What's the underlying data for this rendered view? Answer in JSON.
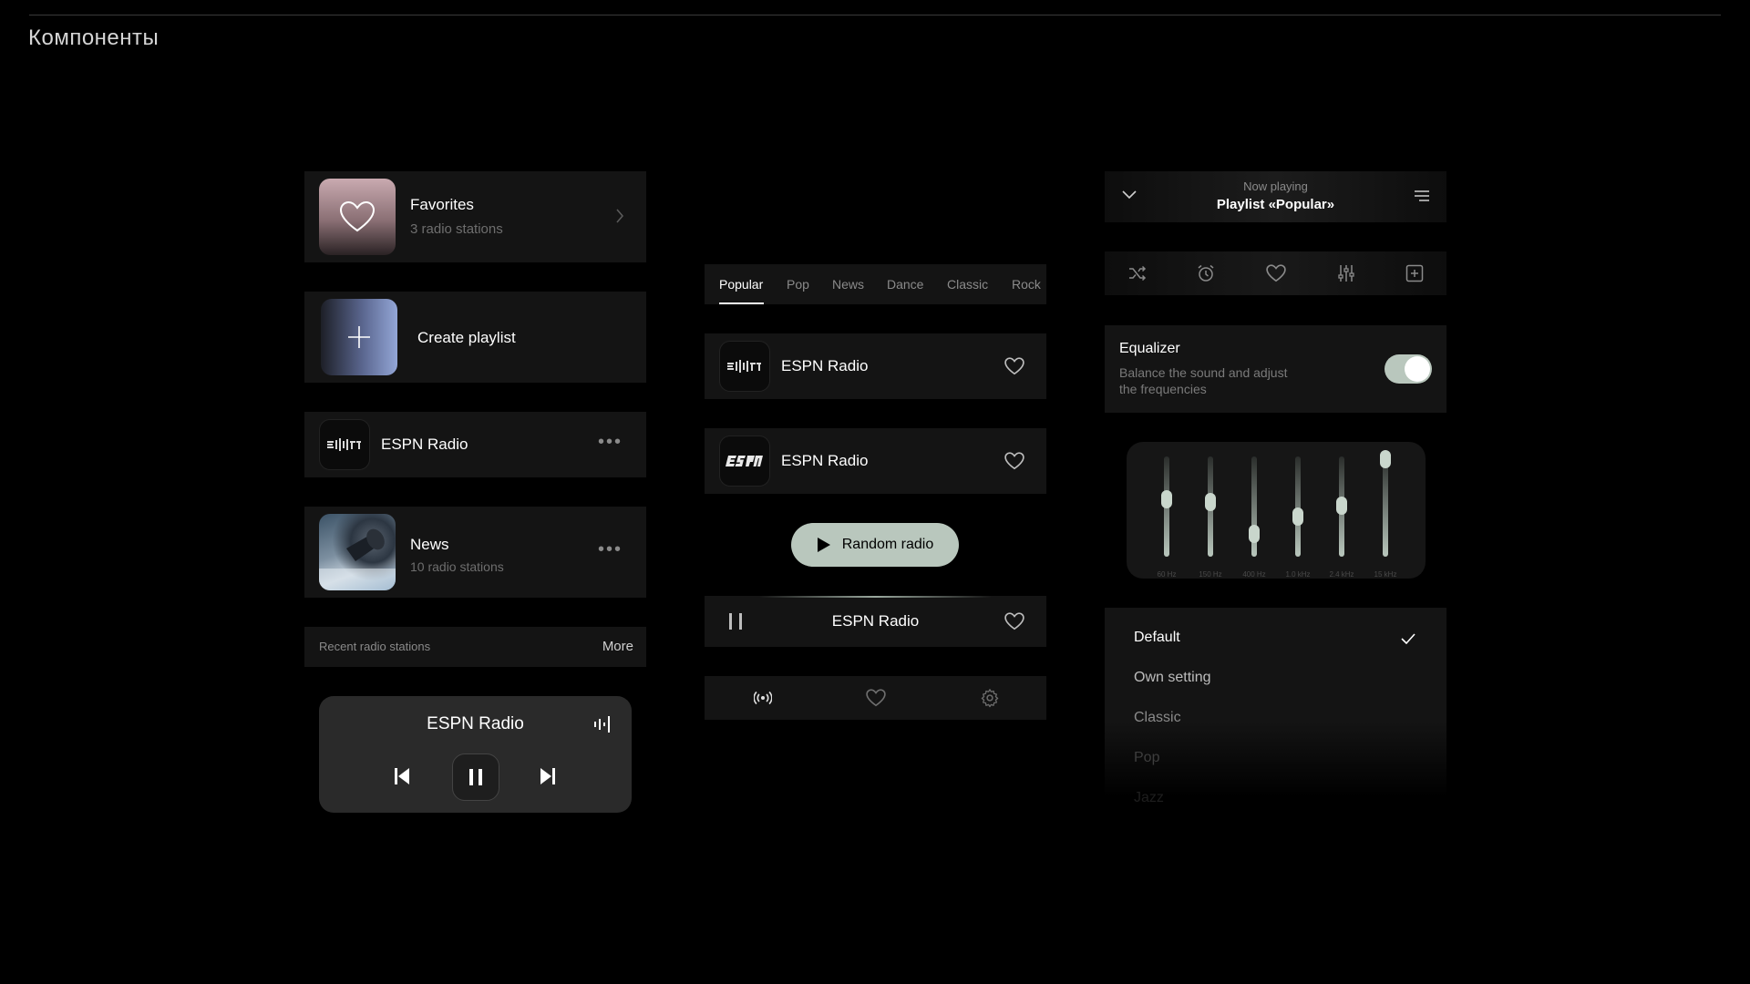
{
  "page": {
    "title": "Компоненты"
  },
  "favorites": {
    "title": "Favorites",
    "subtitle": "3 radio stations"
  },
  "create_playlist": {
    "label": "Create playlist"
  },
  "station_row": {
    "name": "ESPN Radio",
    "logo_text": "ESPN"
  },
  "news_row": {
    "title": "News",
    "subtitle": "10 radio stations"
  },
  "recent": {
    "label": "Recent radio stations",
    "more": "More"
  },
  "mini_player": {
    "station": "ESPN Radio"
  },
  "tabs": [
    "Popular",
    "Pop",
    "News",
    "Dance",
    "Classic",
    "Rock"
  ],
  "station_list": [
    {
      "name": "ESPN Radio",
      "logo_text": "ESPN"
    },
    {
      "name": "ESPN Radio",
      "logo_text": "ESPN"
    }
  ],
  "random_button": {
    "label": "Random radio"
  },
  "now_bar": {
    "station": "ESPN Radio"
  },
  "now_playing": {
    "label": "Now playing",
    "playlist": "Playlist «Popular»"
  },
  "equalizer": {
    "title": "Equalizer",
    "description_line1": "Balance the sound and adjust",
    "description_line2": "the frequencies",
    "enabled": true,
    "bands": [
      {
        "label": "60 Hz",
        "level": 0.57
      },
      {
        "label": "150 Hz",
        "level": 0.55
      },
      {
        "label": "400 Hz",
        "level": 0.23
      },
      {
        "label": "1.0 kHz",
        "level": 0.4
      },
      {
        "label": "2.4 kHz",
        "level": 0.51
      },
      {
        "label": "15 kHz",
        "level": 0.97
      }
    ]
  },
  "presets": {
    "items": [
      "Default",
      "Own setting",
      "Classic",
      "Pop",
      "Jazz"
    ],
    "selected": "Default"
  },
  "colors": {
    "accent": "#b9c7bd",
    "background": "#000000",
    "card": "#141414"
  }
}
